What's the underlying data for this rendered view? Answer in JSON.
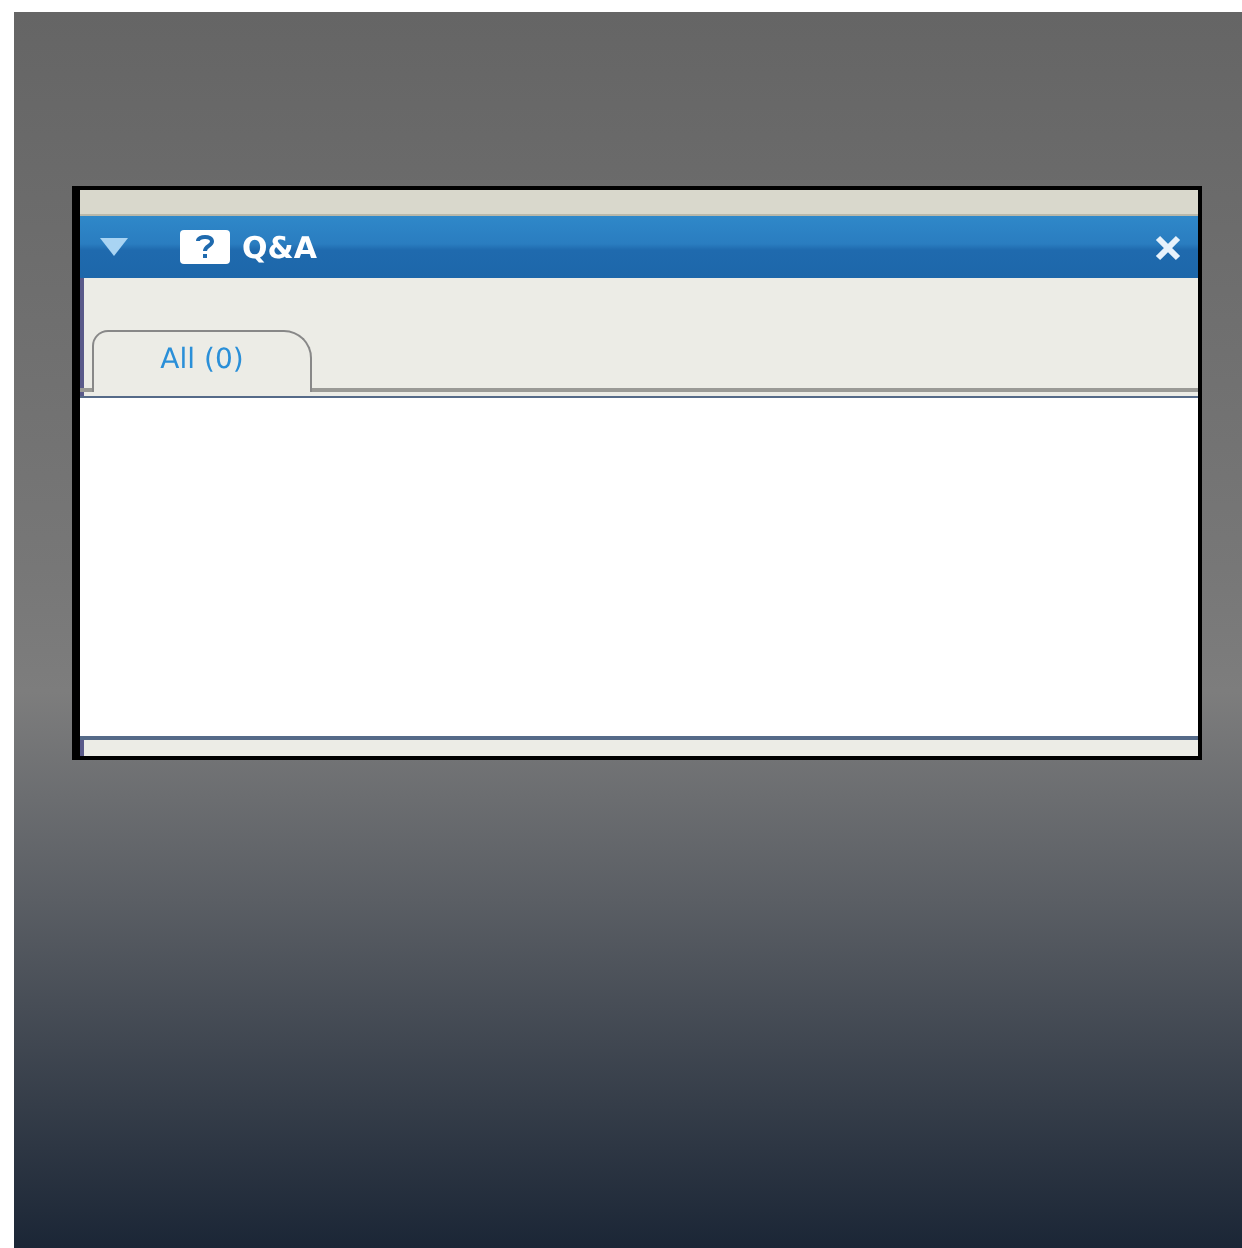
{
  "panel": {
    "title": "Q&A"
  },
  "tabs": [
    {
      "label": "All (0)",
      "selected": true
    }
  ]
}
